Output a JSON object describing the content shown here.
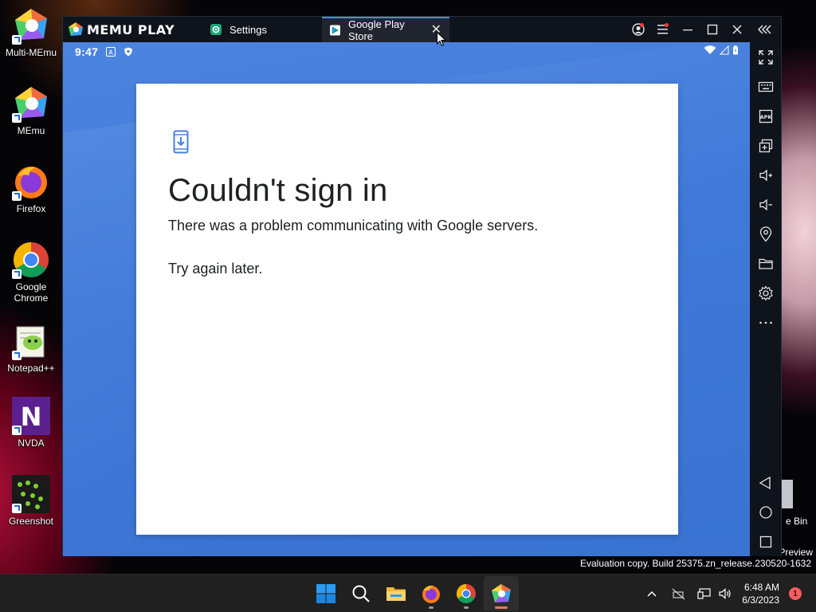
{
  "desktop": {
    "icons": [
      {
        "label": "Multi-MEmu",
        "icon": "multi-memu-icon"
      },
      {
        "label": "MEmu",
        "icon": "memu-icon"
      },
      {
        "label": "Firefox",
        "icon": "firefox-icon"
      },
      {
        "label": "Google Chrome",
        "icon": "chrome-icon"
      },
      {
        "label": "Notepad++",
        "icon": "notepadpp-icon"
      },
      {
        "label": "NVDA",
        "icon": "nvda-icon"
      },
      {
        "label": "Greenshot",
        "icon": "greenshot-icon"
      }
    ],
    "recycle_bin_label": "e Bin",
    "preview_label": "Preview",
    "evaluation_text": "Evaluation copy. Build 25375.zn_release.230520-1632"
  },
  "memu": {
    "brand": "MEMU PLAY",
    "tabs": [
      {
        "label": "Settings",
        "icon": "gear-icon"
      },
      {
        "label": "Google Play Store",
        "icon": "play-store-icon"
      }
    ],
    "titlebar_buttons": [
      "account-icon",
      "menu-icon",
      "minimize-icon",
      "maximize-icon",
      "close-icon",
      "collapse-panel-icon"
    ],
    "tools": [
      "fullscreen-icon",
      "keyboard-icon",
      "apk-icon",
      "multi-window-icon",
      "volume-up-icon",
      "volume-down-icon",
      "location-icon",
      "folder-icon",
      "gear-icon",
      "more-icon"
    ],
    "nav": [
      "back-icon",
      "home-icon",
      "recents-icon"
    ]
  },
  "android": {
    "status": {
      "time": "9:47"
    },
    "dialog": {
      "title": "Couldn't sign in",
      "message": "There was a problem communicating with Google servers.",
      "message2": "Try again later."
    }
  },
  "taskbar": {
    "apps": [
      "start-icon",
      "search-icon",
      "file-explorer-icon",
      "firefox-icon",
      "chrome-icon",
      "memu-icon"
    ],
    "clock_time": "6:48 AM",
    "clock_date": "6/3/2023",
    "notification_count": "1"
  },
  "colors": {
    "android_bg": "#4a82de",
    "accent": "#4a8cf0",
    "taskbar": "#202020"
  }
}
